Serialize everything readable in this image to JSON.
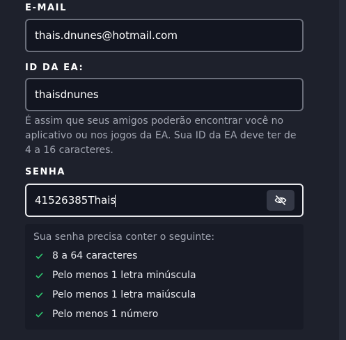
{
  "email": {
    "label": "E-MAIL",
    "value": "thais.dnunes@hotmail.com"
  },
  "ea_id": {
    "label": "ID DA EA:",
    "value": "thaisdnunes",
    "helper": "É assim que seus amigos poderão encontrar você no aplicativo ou nos jogos da EA. Sua ID da EA deve ter de 4 a 16 caracteres."
  },
  "password": {
    "label": "SENHA",
    "value": "41526385Thais",
    "toggle_icon": "eye-slash-icon"
  },
  "requirements": {
    "title": "Sua senha precisa conter o seguinte:",
    "items": [
      {
        "label": "8 a 64 caracteres",
        "met": true
      },
      {
        "label": "Pelo menos 1 letra minúscula",
        "met": true
      },
      {
        "label": "Pelo menos 1 letra maiúscula",
        "met": true
      },
      {
        "label": "Pelo menos 1 número",
        "met": true
      }
    ]
  },
  "colors": {
    "background": "#1e212c",
    "input_background": "#121520",
    "check_green": "#2ecc71",
    "helper_text": "#a3a7b3"
  }
}
